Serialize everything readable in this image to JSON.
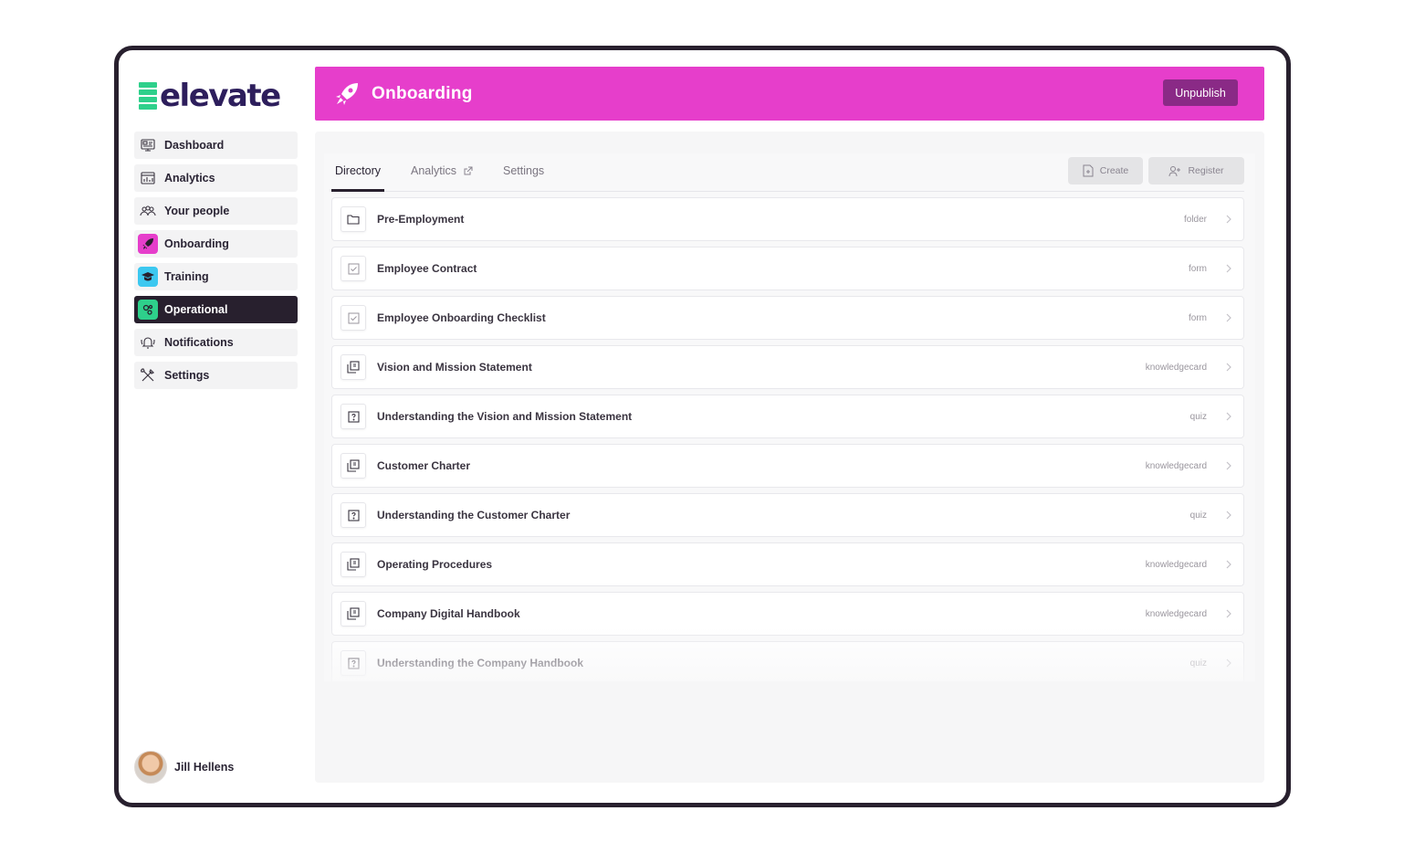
{
  "app": {
    "brand": "elevate"
  },
  "sidebar": {
    "items": [
      {
        "label": "Dashboard",
        "icon": "dashboard-icon"
      },
      {
        "label": "Analytics",
        "icon": "analytics-icon"
      },
      {
        "label": "Your people",
        "icon": "people-icon"
      },
      {
        "label": "Onboarding",
        "icon": "rocket-icon",
        "color": "#e63ecb"
      },
      {
        "label": "Training",
        "icon": "graduation-cap-icon",
        "color": "#3cc8f0"
      },
      {
        "label": "Operational",
        "icon": "operational-icon",
        "color": "#2ed08b",
        "active": true
      },
      {
        "label": "Notifications",
        "icon": "bell-icon"
      },
      {
        "label": "Settings",
        "icon": "tools-icon"
      }
    ]
  },
  "user": {
    "name": "Jill Hellens"
  },
  "header": {
    "title": "Onboarding",
    "action_label": "Unpublish",
    "color": "#e63ecb"
  },
  "tabs": {
    "directory": "Directory",
    "analytics": "Analytics",
    "settings": "Settings"
  },
  "toolbar": {
    "create_label": "Create",
    "register_label": "Register"
  },
  "items": [
    {
      "title": "Pre-Employment",
      "type": "folder",
      "icon": "folder-icon"
    },
    {
      "title": "Employee Contract",
      "type": "form",
      "icon": "checkbox-icon"
    },
    {
      "title": "Employee Onboarding Checklist",
      "type": "form",
      "icon": "checkbox-icon"
    },
    {
      "title": "Vision and Mission Statement",
      "type": "knowledgecard",
      "icon": "knowledgecard-icon"
    },
    {
      "title": "Understanding the Vision and Mission Statement",
      "type": "quiz",
      "icon": "quiz-icon"
    },
    {
      "title": "Customer Charter",
      "type": "knowledgecard",
      "icon": "knowledgecard-icon"
    },
    {
      "title": "Understanding the Customer Charter",
      "type": "quiz",
      "icon": "quiz-icon"
    },
    {
      "title": "Operating Procedures",
      "type": "knowledgecard",
      "icon": "knowledgecard-icon"
    },
    {
      "title": "Company Digital Handbook",
      "type": "knowledgecard",
      "icon": "knowledgecard-icon"
    },
    {
      "title": "Understanding the Company Handbook",
      "type": "quiz",
      "icon": "quiz-icon"
    }
  ]
}
